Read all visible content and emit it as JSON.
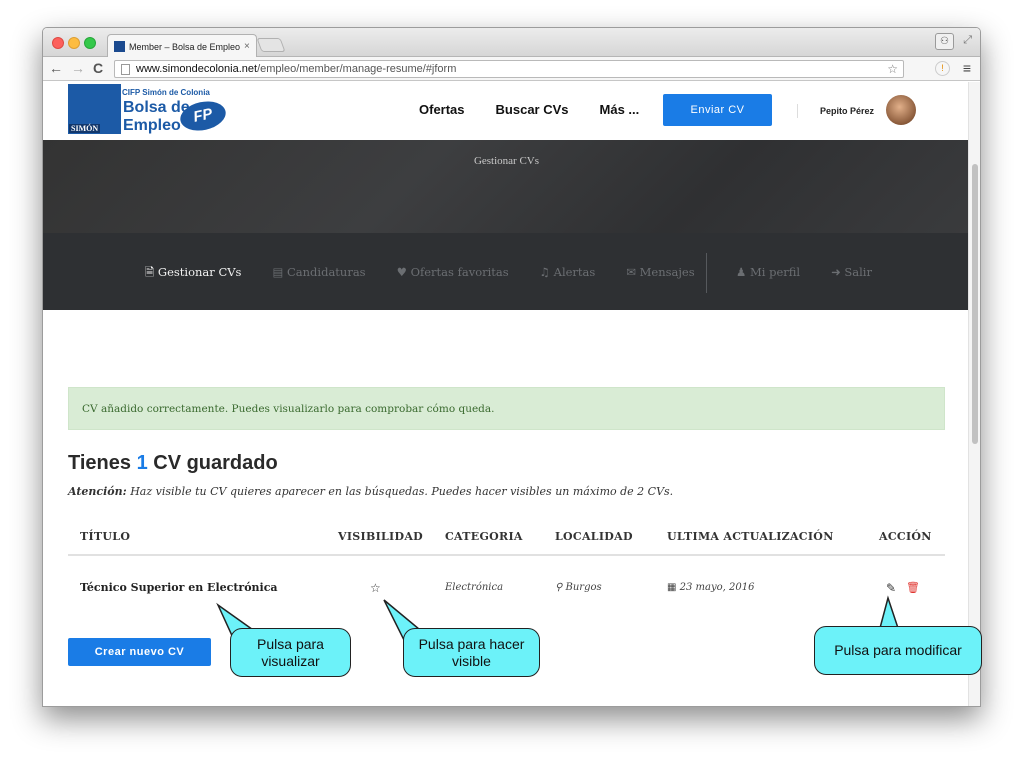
{
  "browser": {
    "tab_title": "Member – Bolsa de Empleo",
    "tab_close": "×",
    "url_host": "www.simondecolonia.net",
    "url_path": "/empleo/member/manage-resume/#jform"
  },
  "site": {
    "logo_small": "CIFP Simón de Colonia",
    "logo_line1": "Bolsa de",
    "logo_line2": "Empleo",
    "logo_badge": "FP",
    "logo_simon": "SIMÓN",
    "nav": [
      "Ofertas",
      "Buscar CVs",
      "Más ..."
    ],
    "send_cv": "Enviar CV",
    "user_name": "Pepito Pérez"
  },
  "hero": {
    "title": "Gestionar CVs"
  },
  "dashboard_nav": {
    "left": [
      {
        "icon": "📄",
        "label": "Gestionar CVs",
        "active": true
      },
      {
        "icon": "▤",
        "label": "Candidaturas"
      },
      {
        "icon": "♥",
        "label": "Ofertas favoritas"
      },
      {
        "icon": "🔔",
        "label": "Alertas"
      },
      {
        "icon": "💬",
        "label": "Mensajes"
      }
    ],
    "right": [
      {
        "icon": "👤",
        "label": "Mi perfil"
      },
      {
        "icon": "➜",
        "label": "Salir"
      }
    ]
  },
  "alert": "CV añadido correctamente. Puedes visualizarlo para comprobar cómo queda.",
  "section": {
    "title_pre": "Tienes ",
    "count": "1",
    "title_post": " CV guardado",
    "notice_label": "Atención:",
    "notice_text": " Haz visible tu CV quieres aparecer en las búsquedas. Puedes hacer visibles un máximo de 2 CVs."
  },
  "table": {
    "headers": [
      "TÍTULO",
      "VISIBILIDAD",
      "CATEGORIA",
      "LOCALIDAD",
      "ULTIMA ACTUALIZACIÓN",
      "ACCIÓN"
    ],
    "rows": [
      {
        "title": "Técnico Superior en Electrónica",
        "visibility_icon": "☆",
        "category": "Electrónica",
        "location": "⚲ Burgos",
        "updated": "▦ 23 mayo, 2016",
        "edit_icon": "✎",
        "delete_icon": "🗑"
      }
    ]
  },
  "create_button": "Crear nuevo CV",
  "callouts": {
    "view": "Pulsa para visualizar",
    "visible": "Pulsa para hacer visible",
    "modify": "Pulsa para modificar"
  },
  "colors": {
    "accent": "#1a7ce6",
    "callout": "#6cf2f9",
    "alert_bg": "#d9ecd5",
    "delete": "#e0342f"
  }
}
